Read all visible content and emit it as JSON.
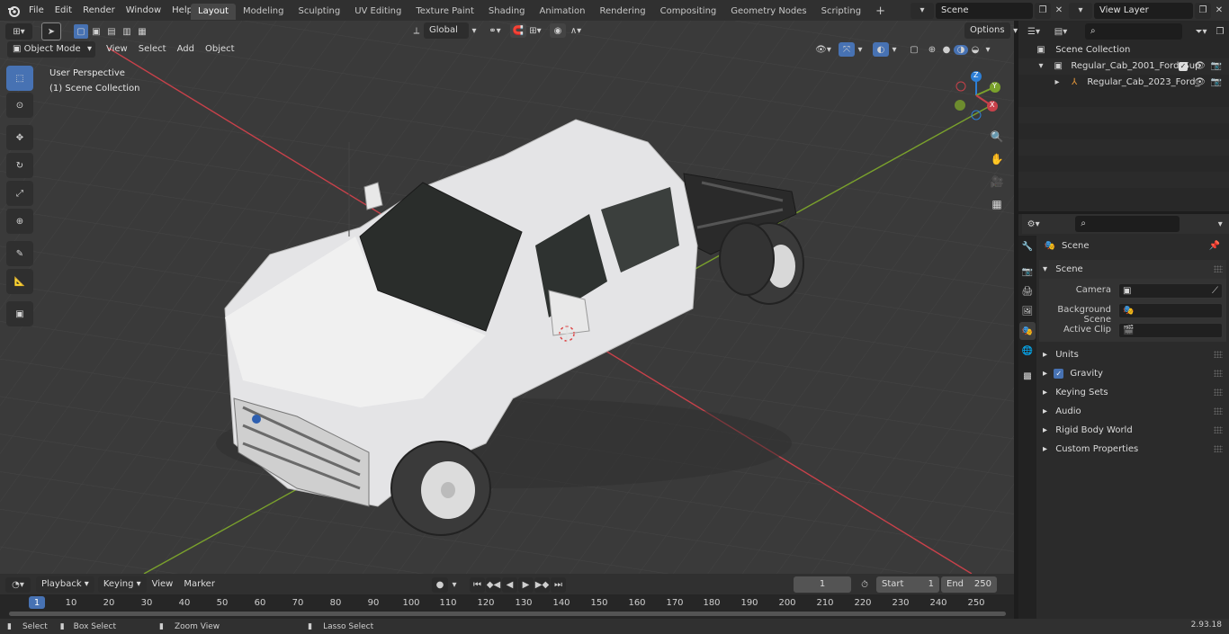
{
  "topbar": {
    "menus": [
      "File",
      "Edit",
      "Render",
      "Window",
      "Help"
    ],
    "workspaces": [
      "Layout",
      "Modeling",
      "Sculpting",
      "UV Editing",
      "Texture Paint",
      "Shading",
      "Animation",
      "Rendering",
      "Compositing",
      "Geometry Nodes",
      "Scripting"
    ],
    "active_workspace": "Layout",
    "add_workspace": "+",
    "scene_name": "Scene",
    "view_layer": "View Layer"
  },
  "viewport": {
    "mode": "Object Mode",
    "menus": [
      "View",
      "Select",
      "Add",
      "Object"
    ],
    "transform_orientation": "Global",
    "options_label": "Options",
    "overlay_title": "User Perspective",
    "overlay_subtitle": "(1) Scene Collection",
    "gizmo": {
      "x": "X",
      "y": "Y",
      "z": "Z"
    }
  },
  "outliner": {
    "root": "Scene Collection",
    "items": [
      {
        "label": "Regular_Cab_2001_Ford_Sup",
        "level": 1
      },
      {
        "label": "Regular_Cab_2023_Ford_",
        "level": 2
      }
    ]
  },
  "properties": {
    "context": "Scene",
    "panel": "Scene",
    "fields": [
      {
        "label": "Camera"
      },
      {
        "label": "Background Scene"
      },
      {
        "label": "Active Clip"
      }
    ],
    "subpanels": [
      "Units",
      "Gravity",
      "Keying Sets",
      "Audio",
      "Rigid Body World",
      "Custom Properties"
    ]
  },
  "timeline": {
    "menus": [
      "Playback",
      "Keying",
      "View",
      "Marker"
    ],
    "current_frame": "1",
    "start_label": "Start",
    "start": "1",
    "end_label": "End",
    "end": "250",
    "ticks": [
      "1",
      "10",
      "20",
      "30",
      "40",
      "50",
      "60",
      "70",
      "80",
      "90",
      "100",
      "110",
      "120",
      "130",
      "140",
      "150",
      "160",
      "170",
      "180",
      "190",
      "200",
      "210",
      "220",
      "230",
      "240",
      "250"
    ]
  },
  "statusbar": {
    "items": [
      "Select",
      "Box Select",
      "Zoom View",
      "Lasso Select"
    ],
    "version": "2.93.18"
  },
  "colors": {
    "accent": "#4772b3",
    "axis_x": "#c8414a",
    "axis_y": "#7aa12c",
    "axis_z": "#2d7fd6"
  }
}
